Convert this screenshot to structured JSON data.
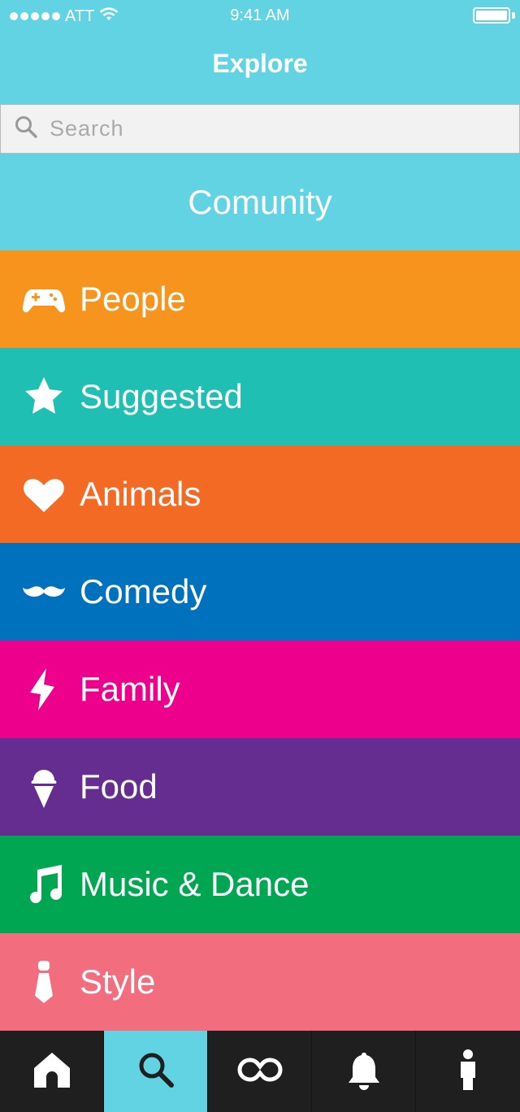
{
  "status_bar": {
    "carrier": "ATT",
    "time": "9:41 AM"
  },
  "header": {
    "title": "Explore"
  },
  "search": {
    "placeholder": "Search"
  },
  "section": {
    "title": "Comunity"
  },
  "categories": [
    {
      "label": "People",
      "icon": "gamepad-icon",
      "color": "#f7941e"
    },
    {
      "label": "Suggested",
      "icon": "star-icon",
      "color": "#1fbfb3"
    },
    {
      "label": "Animals",
      "icon": "heart-icon",
      "color": "#f26a24"
    },
    {
      "label": "Comedy",
      "icon": "mustache-icon",
      "color": "#0071bc"
    },
    {
      "label": "Family",
      "icon": "lightning-icon",
      "color": "#ec008c"
    },
    {
      "label": "Food",
      "icon": "ice-cream-icon",
      "color": "#662d91"
    },
    {
      "label": "Music & Dance",
      "icon": "music-note-icon",
      "color": "#00a651"
    },
    {
      "label": "Style",
      "icon": "tie-icon",
      "color": "#f26d7d"
    }
  ],
  "tab_bar": {
    "items": [
      {
        "icon": "home-icon",
        "active": false
      },
      {
        "icon": "search-icon",
        "active": true
      },
      {
        "icon": "infinity-icon",
        "active": false
      },
      {
        "icon": "bell-icon",
        "active": false
      },
      {
        "icon": "person-icon",
        "active": false
      }
    ],
    "active_color": "#62d3e3",
    "background": "#1f1f1f"
  }
}
